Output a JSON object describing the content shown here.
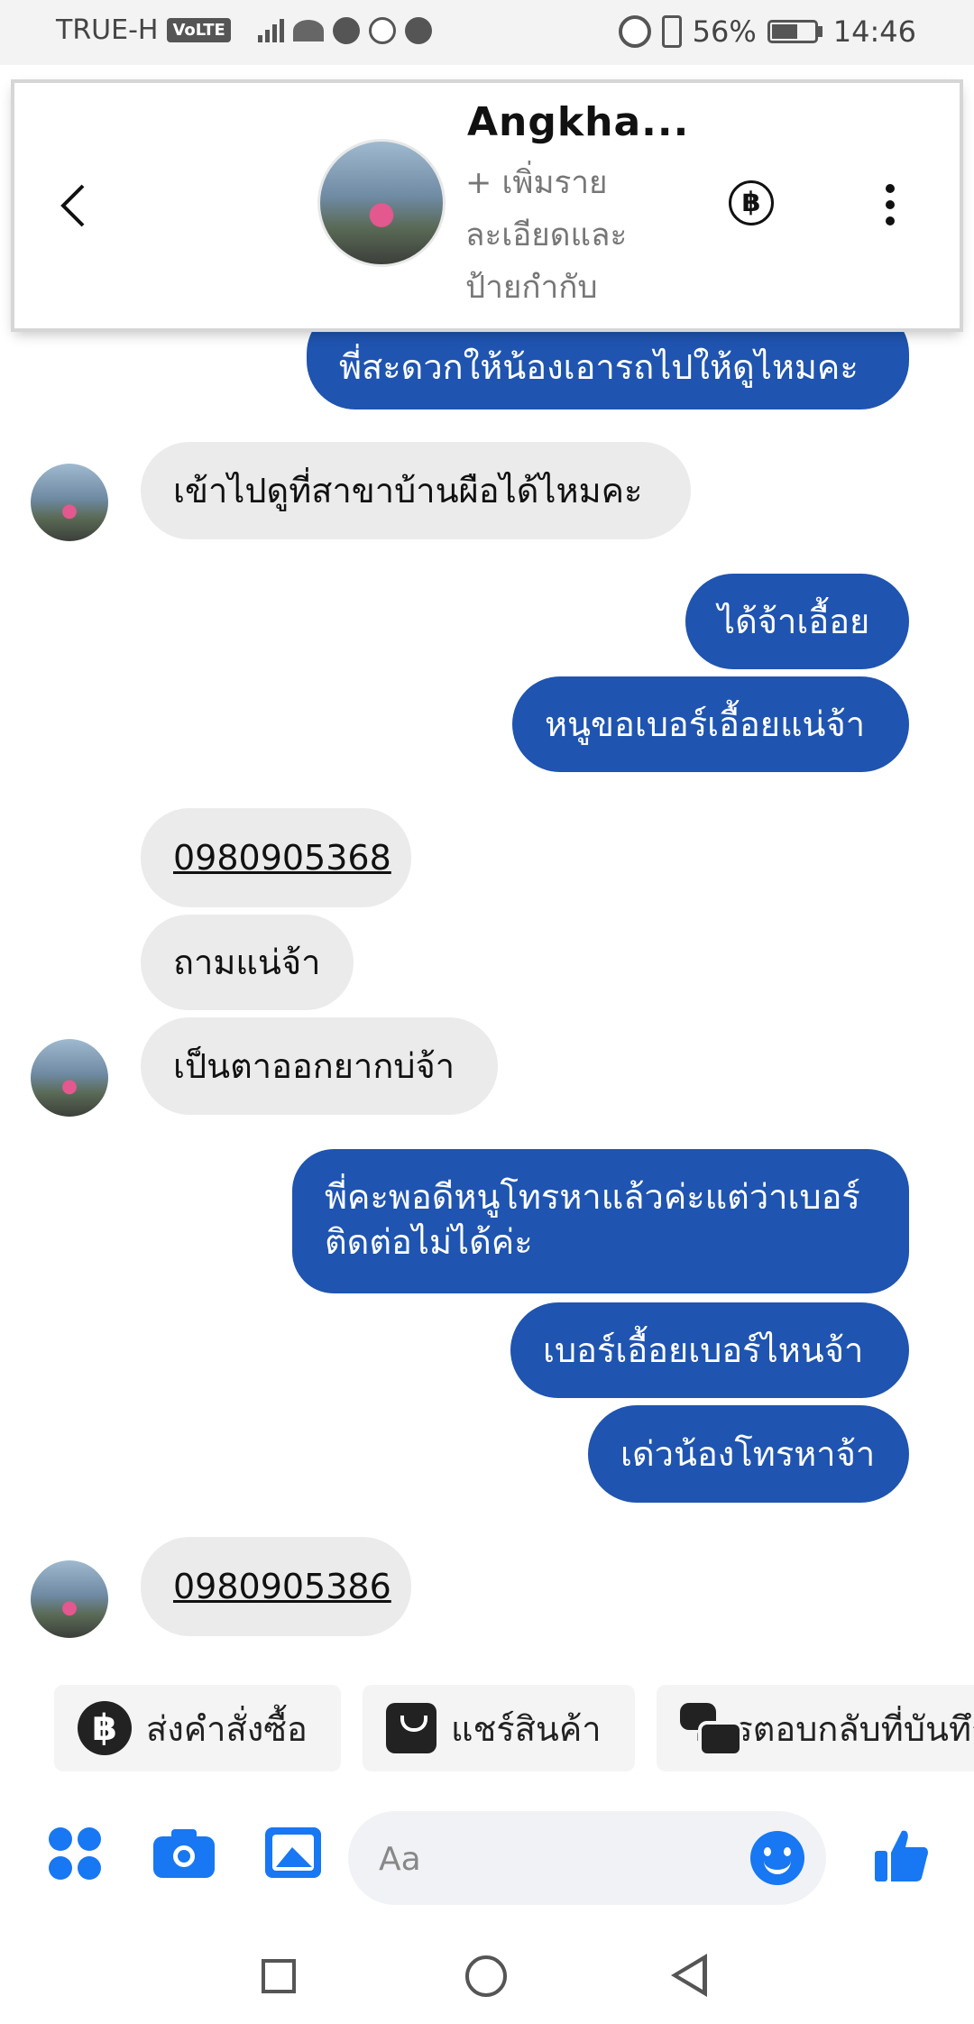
{
  "status_bar": {
    "carrier": "TRUE-H",
    "volte": "VoLTE",
    "battery": "56%",
    "time": "14:46"
  },
  "header": {
    "name": "Angkha...",
    "subtitle": "+ เพิ่มรายละเอียดและป้ายกำกับ",
    "currency_symbol": "฿"
  },
  "messages": [
    {
      "side": "me",
      "text": "พี่สะดวกให้น้องเอารถไปให้ดูไหมคะ"
    },
    {
      "side": "them",
      "text": "เข้าไปดูที่สาขาบ้านผือได้ไหมคะ"
    },
    {
      "side": "me",
      "text": "ได้จ้าเอื้อย"
    },
    {
      "side": "me",
      "text": "หนูขอเบอร์เอื้อยแน่จ้า"
    },
    {
      "side": "them",
      "text": "0980905368"
    },
    {
      "side": "them",
      "text": "ถามแน่จ้า"
    },
    {
      "side": "them",
      "text": "เป็นตาออกยากบ่จ้า"
    },
    {
      "side": "me",
      "line1": "พี่คะพอดีหนูโทรหาแล้วค่ะแต่ว่าเบอร์",
      "line2": "ติดต่อไม่ได้ค่ะ"
    },
    {
      "side": "me",
      "text": "เบอร์เอื้อยเบอร์ไหนจ้า"
    },
    {
      "side": "me",
      "text": "เด่วน้องโทรหาจ้า"
    },
    {
      "side": "them",
      "text": "0980905386"
    }
  ],
  "quick_replies": [
    {
      "label": "ส่งคำสั่งซื้อ",
      "icon": "baht-icon",
      "symbol": "฿"
    },
    {
      "label": "แชร์สินค้า",
      "icon": "shopping-bag-icon"
    },
    {
      "label": "การตอบกลับที่บันทึกไว้",
      "icon": "chat-bubbles-icon"
    }
  ],
  "composer": {
    "placeholder": "Aa"
  },
  "colors": {
    "outgoing": "#1f54b0",
    "incoming": "#ebebeb",
    "accent": "#1877f2"
  }
}
